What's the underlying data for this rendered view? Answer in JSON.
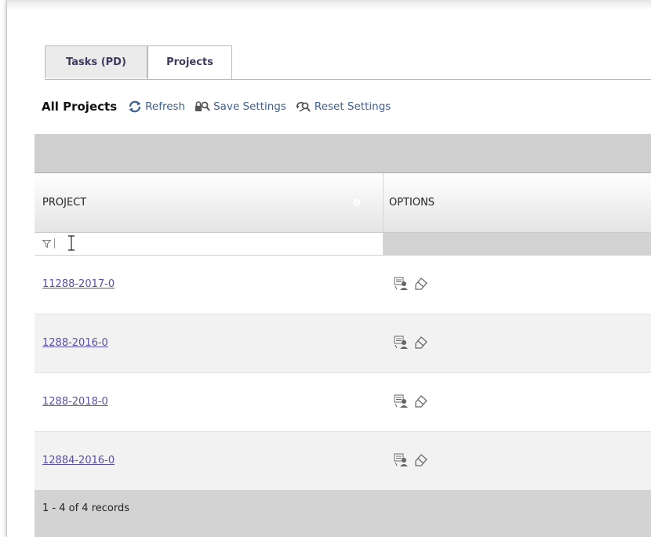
{
  "tabs": [
    {
      "label": "Tasks (PD)",
      "active": false
    },
    {
      "label": "Projects",
      "active": true
    }
  ],
  "toolbar": {
    "title": "All Projects",
    "refresh_label": "Refresh",
    "save_label": "Save Settings",
    "reset_label": "Reset Settings"
  },
  "grid": {
    "columns": [
      "PROJECT",
      "OPTIONS"
    ],
    "filter": {
      "value": "",
      "icon": "filter-icon"
    },
    "rows": [
      {
        "project": "11288-2017-0"
      },
      {
        "project": "1288-2016-0"
      },
      {
        "project": "1288-2018-0"
      },
      {
        "project": "12884-2016-0"
      }
    ],
    "option_icons": [
      "assign-user-icon",
      "edit-eraser-icon"
    ],
    "footer": "1 - 4 of 4 records"
  },
  "colors": {
    "link": "#5b4fa3",
    "toolbar_link": "#3a5f93",
    "tab_text": "#3e3a5e"
  }
}
